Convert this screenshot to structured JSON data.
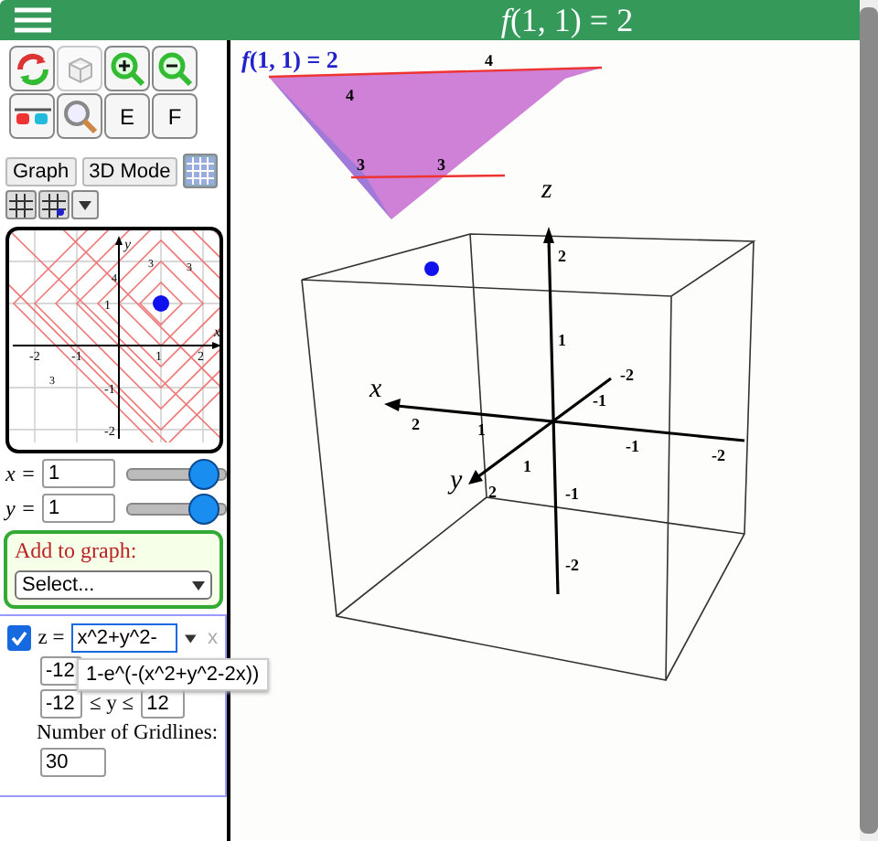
{
  "header": {
    "title": "*f*(1, 1) = 2"
  },
  "icon_tools": [
    {
      "disabled": false
    },
    {
      "disabled": true
    },
    {
      "disabled": false
    },
    {
      "disabled": false
    },
    {
      "disabled": false
    },
    {
      "disabled": false
    }
  ],
  "letter_tools": [
    "E",
    "F"
  ],
  "mode_buttons": [
    "Graph",
    "3D Mode"
  ],
  "contour": {
    "x_ticks": [
      "-2",
      "-1",
      "1",
      "2"
    ],
    "y_ticks": [
      "1",
      "-1",
      "-2"
    ],
    "x_axis": "x",
    "y_axis": "y",
    "labels": [
      "4",
      "3",
      "3",
      "3"
    ]
  },
  "sliders": [
    {
      "label": "x =",
      "value": "1",
      "level": 0.86
    },
    {
      "label": "y =",
      "value": "1",
      "level": 0.86
    }
  ],
  "add_to_graph": {
    "label": "Add to graph:",
    "select": "Select..."
  },
  "function": {
    "checked": true,
    "lhs": "z =",
    "value": "x^2+y^2-",
    "remove": "x",
    "suggestion": "1-e^(-(x^2+y^2-2x))",
    "x_min": "-12",
    "y_min": "-12",
    "y_relation": "≤ y ≤",
    "y_max": "12",
    "gridlines_label": "Number of Gridlines:",
    "gridlines": "30"
  },
  "plot": {
    "value_label": "*f*(1, 1) = 2",
    "axes": [
      "x",
      "y",
      "z"
    ],
    "x_ticks": [
      "2",
      "1",
      "-1",
      "-2"
    ],
    "y_ticks": [
      "2",
      "1",
      "-1",
      "-2"
    ],
    "z_ticks": [
      "2",
      "1",
      "-1",
      "-2"
    ],
    "surface_labels": [
      "4",
      "4",
      "3",
      "3"
    ]
  }
}
